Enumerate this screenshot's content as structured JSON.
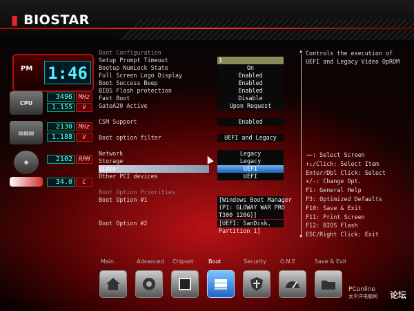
{
  "brand": {
    "name": "BIOSTAR"
  },
  "monitor": {
    "pm": "PM",
    "clock": "1:46",
    "cpu_label": "CPU",
    "cpu_freq": "3496",
    "cpu_freq_unit": "MHz",
    "cpu_volt": "1.155",
    "cpu_volt_unit": "V",
    "mem_freq": "2130",
    "mem_freq_unit": "MHz",
    "mem_volt": "1.188",
    "mem_volt_unit": "V",
    "fan_rpm": "2102",
    "fan_unit": "RPM",
    "temp": "34.0",
    "temp_unit": "C"
  },
  "boot": {
    "section_title": "Boot Configuration",
    "rows": [
      {
        "label": "Setup Prompt Timeout",
        "value": "1"
      },
      {
        "label": "Bootup NumLock State",
        "value": "On"
      },
      {
        "label": "Full Screen Logo Display",
        "value": "Enabled"
      },
      {
        "label": "Boot Success Beep",
        "value": "Enabled"
      },
      {
        "label": "BIOS Flash protection",
        "value": "Enabled"
      },
      {
        "label": "Fast Boot",
        "value": "Disable"
      },
      {
        "label": "GateA20 Active",
        "value": "Upon Request"
      },
      {
        "label": "CSM Support",
        "value": "Enabled"
      },
      {
        "label": "Boot option filter",
        "value": "UEFI and Legacy"
      },
      {
        "label": "Network",
        "value": "Legacy"
      },
      {
        "label": "Storage",
        "value": "Legacy"
      },
      {
        "label": "Video",
        "value": "UEFI"
      },
      {
        "label": "Other PCI devices",
        "value": "UEFI"
      }
    ],
    "priorities_title": "Boot Option Priorities",
    "option1_label": "Boot Option #1",
    "option1_lines": [
      "[Windows Boot Manager",
      "(P1: GLOWAY WAR PRO",
      "T300 120G)]"
    ],
    "option2_label": "Boot Option #2",
    "option2_lines": [
      "[UEFI: SanDisk,",
      "Partition 1]"
    ]
  },
  "help": {
    "text": "Controls the execution of UEFI and Legacy Video OpROM",
    "keys": [
      "→←: Select Screen",
      "↑↓/Click: Select Item",
      "Enter/Dbl Click: Select",
      "+/-: Change Opt.",
      "F1: General Help",
      "F3: Optimized Defaults",
      "F10: Save & Exit",
      "F11: Print Screen",
      "F12: BIOS Flash",
      "ESC/Right Click: Exit"
    ]
  },
  "nav": {
    "tabs": [
      "Main",
      "Advanced",
      "Chipset",
      "Boot",
      "Security",
      "O.N.E",
      "Save & Exit"
    ],
    "active": "Boot"
  },
  "watermark": {
    "site": "PConline",
    "sub": "太平洋电脑网",
    "forum": "论坛"
  },
  "colors": {
    "accent": "#e22222",
    "selected": "#1d63b7"
  }
}
